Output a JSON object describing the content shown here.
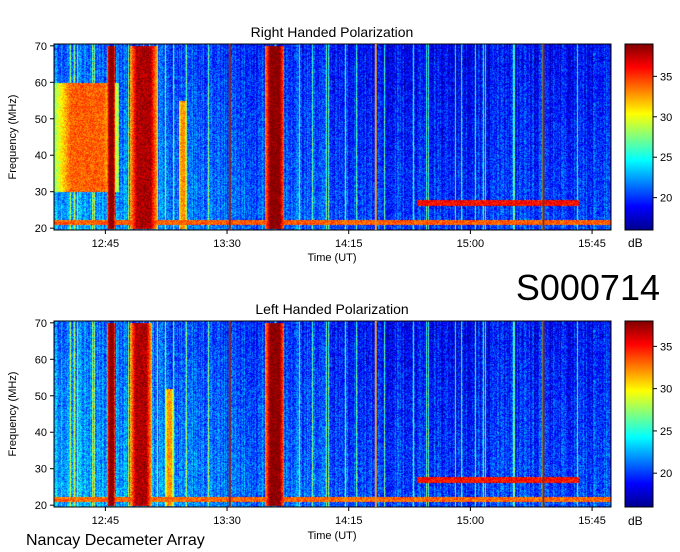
{
  "figure": {
    "observation_id": "S000714",
    "instrument": "Nancay Decameter Array"
  },
  "chart_data": [
    {
      "type": "heatmap",
      "id": "rh",
      "title": "Right Handed Polarization",
      "xlabel": "Time (UT)",
      "ylabel": "Frequency (MHz)",
      "x_ticks": [
        "12:45",
        "13:30",
        "14:15",
        "15:00",
        "15:45"
      ],
      "x_tick_minutes": [
        765,
        810,
        855,
        900,
        945
      ],
      "xlim_minutes": [
        746,
        952
      ],
      "ylim": [
        19.5,
        70.5
      ],
      "y_ticks": [
        20,
        30,
        40,
        50,
        60,
        70
      ],
      "colorbar": {
        "label": "dB",
        "range": [
          16,
          39
        ],
        "ticks": [
          20,
          25,
          30,
          35
        ]
      },
      "emissions": [
        {
          "start": 765.5,
          "end": 768.5,
          "fmin": 20,
          "fmax": 70,
          "intensity": 39
        },
        {
          "start": 774,
          "end": 784,
          "fmin": 20,
          "fmax": 70,
          "intensity": 38
        },
        {
          "start": 792,
          "end": 795,
          "fmin": 20,
          "fmax": 55,
          "intensity": 33
        },
        {
          "start": 824,
          "end": 831,
          "fmin": 20,
          "fmax": 70,
          "intensity": 39
        },
        {
          "start": 746,
          "end": 770,
          "fmin": 30,
          "fmax": 60,
          "intensity": 34
        }
      ],
      "bands": [
        {
          "fmin": 21,
          "fmax": 22.3,
          "start": 746,
          "end": 952,
          "intensity": 34
        },
        {
          "fmin": 26.3,
          "fmax": 27.8,
          "start": 880,
          "end": 940,
          "intensity": 36
        }
      ],
      "markers": [
        {
          "time": 811,
          "color": "#8b2a1a"
        },
        {
          "time": 865,
          "color": "#e8912a"
        },
        {
          "time": 927,
          "color": "#8b2a1a"
        }
      ]
    },
    {
      "type": "heatmap",
      "id": "lh",
      "title": "Left Handed Polarization",
      "xlabel": "Time (UT)",
      "ylabel": "Frequency (MHz)",
      "x_ticks": [
        "12:45",
        "13:30",
        "14:15",
        "15:00",
        "15:45"
      ],
      "x_tick_minutes": [
        765,
        810,
        855,
        900,
        945
      ],
      "xlim_minutes": [
        746,
        952
      ],
      "ylim": [
        19.5,
        70.5
      ],
      "y_ticks": [
        20,
        30,
        40,
        50,
        60,
        70
      ],
      "colorbar": {
        "label": "dB",
        "range": [
          16,
          38
        ],
        "ticks": [
          20,
          25,
          30,
          35
        ]
      },
      "emissions": [
        {
          "start": 765.5,
          "end": 768.5,
          "fmin": 20,
          "fmax": 70,
          "intensity": 38
        },
        {
          "start": 774,
          "end": 782,
          "fmin": 20,
          "fmax": 70,
          "intensity": 37
        },
        {
          "start": 787,
          "end": 790,
          "fmin": 20,
          "fmax": 52,
          "intensity": 32
        },
        {
          "start": 824,
          "end": 831,
          "fmin": 20,
          "fmax": 70,
          "intensity": 38
        }
      ],
      "bands": [
        {
          "fmin": 21,
          "fmax": 22.3,
          "start": 746,
          "end": 952,
          "intensity": 33
        },
        {
          "fmin": 26.3,
          "fmax": 27.8,
          "start": 880,
          "end": 940,
          "intensity": 35
        }
      ],
      "markers": [
        {
          "time": 811,
          "color": "#8b2a1a"
        },
        {
          "time": 865,
          "color": "#e8912a"
        },
        {
          "time": 927,
          "color": "#8b2a1a"
        }
      ]
    }
  ]
}
